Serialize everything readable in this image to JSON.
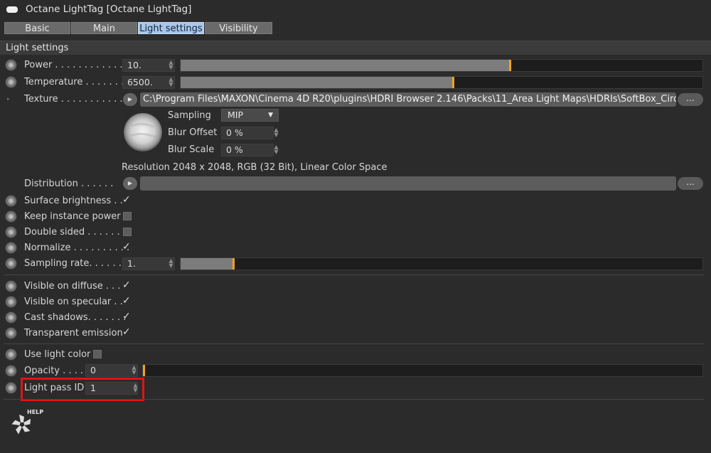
{
  "window": {
    "title": "Octane LightTag [Octane LightTag]"
  },
  "tabs": [
    {
      "label": "Basic",
      "active": false
    },
    {
      "label": "Main",
      "active": false
    },
    {
      "label": "Light settings",
      "active": true
    },
    {
      "label": "Visibility",
      "active": false
    }
  ],
  "section": {
    "title": "Light settings"
  },
  "params": {
    "power": {
      "label": "Power . . . . . . . . . . . .",
      "value": "10.",
      "slider_fraction": 0.63
    },
    "temperature": {
      "label": "Temperature . . . . . . .",
      "value": "6500.",
      "slider_fraction": 0.52
    },
    "texture": {
      "label": "Texture . . . . . . . . . . . .",
      "path": "C:\\Program Files\\MAXON\\Cinema 4D R20\\plugins\\HDRI Browser 2.146\\Packs\\11_Area Light Maps\\HDRIs\\SoftBox_Circle_S",
      "button": "...",
      "sampling_label": "Sampling",
      "sampling_value": "MIP",
      "blur_offset_label": "Blur Offset",
      "blur_offset_value": "0 %",
      "blur_scale_label": "Blur Scale",
      "blur_scale_value": "0 %",
      "resolution": "Resolution 2048 x 2048, RGB (32 Bit), Linear Color Space"
    },
    "distribution": {
      "label": "Distribution . . . . . .",
      "button": "..."
    },
    "surface_brightness": {
      "label": "Surface brightness . .",
      "checked": "✓"
    },
    "keep_instance_power": {
      "label": "Keep instance power",
      "checked": false
    },
    "double_sided": {
      "label": "Double sided . . . . . . .",
      "checked": false
    },
    "normalize": {
      "label": "Normalize . . . . . . . . . .",
      "checked": "✓"
    },
    "sampling_rate": {
      "label": "Sampling rate. . . . . . .",
      "value": "1.",
      "slider_fraction": 0.1
    },
    "visible_on_diffuse": {
      "label": "Visible on diffuse . . .",
      "checked": "✓"
    },
    "visible_on_specular": {
      "label": "Visible on specular . .",
      "checked": "✓"
    },
    "cast_shadows": {
      "label": "Cast shadows. . . . . . .",
      "checked": "✓"
    },
    "transparent_emission": {
      "label": "Transparent emission",
      "checked": "✓"
    },
    "use_light_color": {
      "label": "Use light color",
      "checked": false
    },
    "opacity": {
      "label": "Opacity . . . .",
      "value": "0",
      "slider_fraction": 0.0
    },
    "light_pass_id": {
      "label": "Light pass ID",
      "value": "1"
    }
  },
  "help": {
    "label": "HELP",
    "icon": "octane-logo-icon"
  },
  "colors": {
    "accent_marker": "#f2a21c",
    "active_tab": "#a9c7ea",
    "highlight": "#e01414"
  }
}
